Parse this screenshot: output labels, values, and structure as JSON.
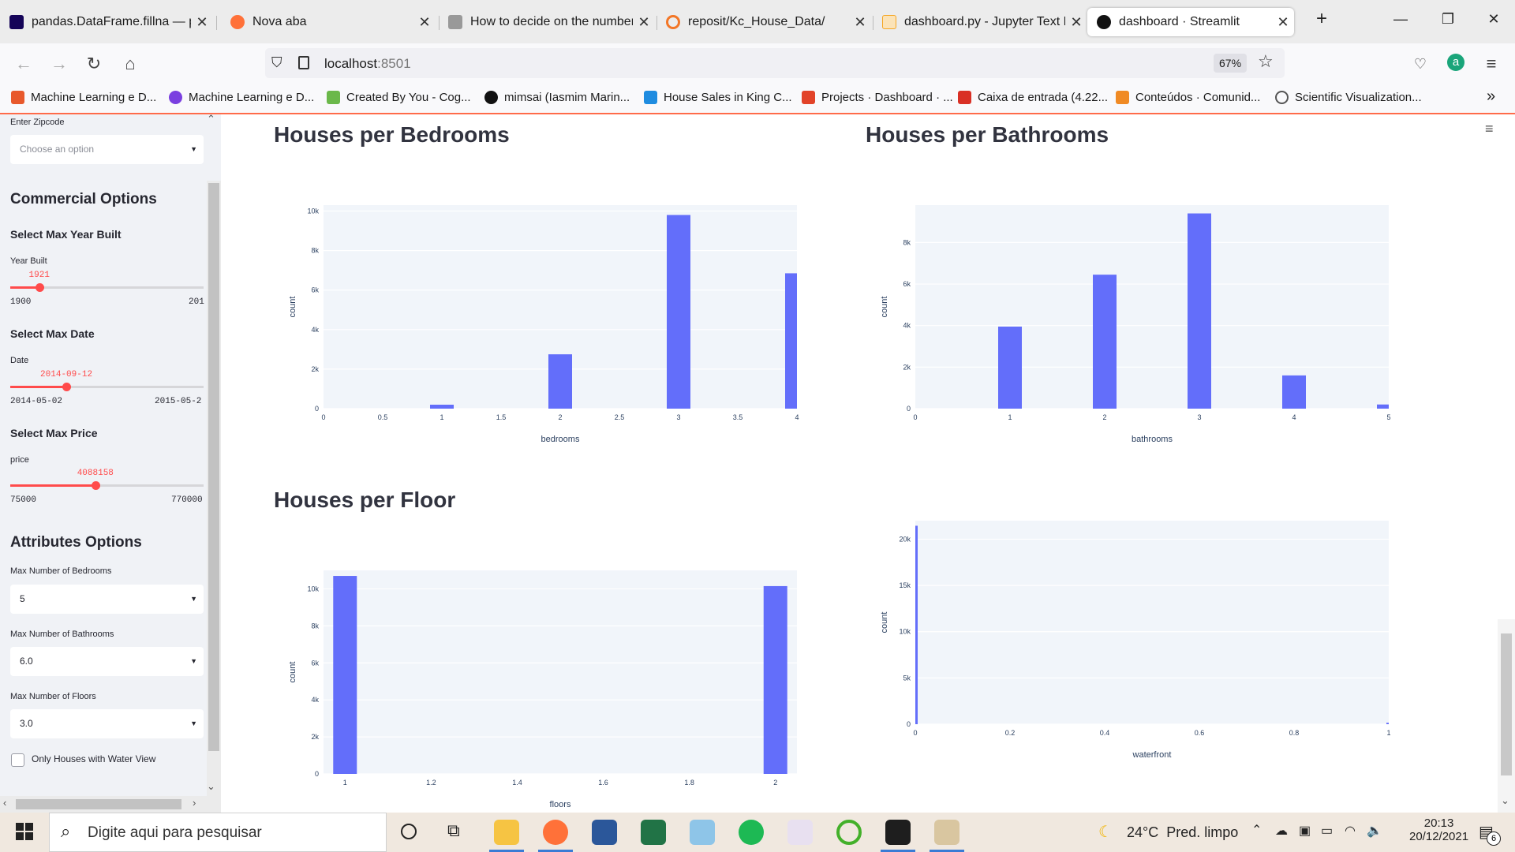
{
  "browser": {
    "tabs": [
      {
        "title": "pandas.DataFrame.fillna — par",
        "color": "#150458",
        "active": false
      },
      {
        "title": "Nova aba",
        "color": "#ff7139",
        "active": false
      },
      {
        "title": "How to decide on the number",
        "color": "#888888",
        "active": false
      },
      {
        "title": "reposit/Kc_House_Data/",
        "color": "#f37626",
        "active": false
      },
      {
        "title": "dashboard.py - Jupyter Text Ed",
        "color": "#f5a623",
        "active": false
      },
      {
        "title": "dashboard · Streamlit",
        "color": "#111111",
        "active": true
      }
    ],
    "new_tab": "+",
    "url_host": "localhost",
    "url_port": ":8501",
    "zoom": "67%",
    "bookmarks": [
      {
        "label": "Machine Learning e D...",
        "color": "#e8592c"
      },
      {
        "label": "Machine Learning e D...",
        "color": "#7a3fe0"
      },
      {
        "label": "Created By You - Cog...",
        "color": "#6bb84a"
      },
      {
        "label": "mimsai (Iasmim Marin...",
        "color": "#111111"
      },
      {
        "label": "House Sales in King C...",
        "color": "#1f8ce0"
      },
      {
        "label": "Projects · Dashboard · ...",
        "color": "#e24329"
      },
      {
        "label": "Caixa de entrada (4.22...",
        "color": "#d93025"
      },
      {
        "label": "Conteúdos · Comunid...",
        "color": "#f08a24"
      },
      {
        "label": "Scientific Visualization...",
        "color": "#555555"
      }
    ],
    "more": "»"
  },
  "sidebar": {
    "zipcode_label": "Enter Zipcode",
    "zipcode_placeholder": "Choose an option",
    "commercial_title": "Commercial Options",
    "year_title": "Select Max Year Built",
    "year_label": "Year Built",
    "year_value": "1921",
    "year_min": "1900",
    "year_max": "201",
    "year_fraction": 0.15,
    "date_title": "Select Max Date",
    "date_label": "Date",
    "date_value": "2014-09-12",
    "date_min": "2014-05-02",
    "date_max": "2015-05-2",
    "date_fraction": 0.29,
    "price_title": "Select Max Price",
    "price_label": "price",
    "price_value": "4088158",
    "price_min": "75000",
    "price_max": "770000",
    "price_fraction": 0.44,
    "attributes_title": "Attributes Options",
    "bedrooms_label": "Max Number of Bedrooms",
    "bedrooms_value": "5",
    "bathrooms_label": "Max Number of Bathrooms",
    "bathrooms_value": "6.0",
    "floors_label": "Max Number of Floors",
    "floors_value": "3.0",
    "waterview_label": "Only Houses with Water View"
  },
  "main": {
    "bedrooms_title": "Houses per Bedrooms",
    "bathrooms_title": "Houses per Bathrooms",
    "floors_title": "Houses per Floor"
  },
  "chart_data": [
    {
      "id": "bedrooms",
      "type": "bar",
      "xlabel": "bedrooms",
      "ylabel": "count",
      "xlim": [
        0,
        4
      ],
      "ylim": [
        0,
        10300
      ],
      "xticks": [
        "0",
        "0.5",
        "1",
        "1.5",
        "2",
        "2.5",
        "3",
        "3.5",
        "4"
      ],
      "yticks": [
        "0",
        "2k",
        "4k",
        "6k",
        "8k",
        "10k"
      ],
      "x": [
        1,
        2,
        3,
        4
      ],
      "values": [
        200,
        2750,
        9800,
        6850
      ],
      "bar_width": 0.05,
      "color": "#636efa"
    },
    {
      "id": "bathrooms",
      "type": "bar",
      "xlabel": "bathrooms",
      "ylabel": "count",
      "xlim": [
        0,
        5
      ],
      "ylim": [
        0,
        9800
      ],
      "xticks": [
        "0",
        "1",
        "2",
        "3",
        "4",
        "5"
      ],
      "yticks": [
        "0",
        "2k",
        "4k",
        "6k",
        "8k"
      ],
      "x": [
        1,
        2,
        3,
        4,
        5
      ],
      "values": [
        3950,
        6450,
        9400,
        1600,
        200
      ],
      "bar_width": 0.05,
      "color": "#636efa"
    },
    {
      "id": "floors",
      "type": "bar",
      "xlabel": "floors",
      "ylabel": "count",
      "xlim": [
        0.95,
        2.05
      ],
      "ylim": [
        0,
        11000
      ],
      "xticks": [
        "1",
        "1.2",
        "1.4",
        "1.6",
        "1.8",
        "2"
      ],
      "yticks": [
        "0",
        "2k",
        "4k",
        "6k",
        "8k",
        "10k"
      ],
      "x": [
        1,
        2
      ],
      "values": [
        10700,
        10150
      ],
      "bar_width": 0.05,
      "color": "#636efa"
    },
    {
      "id": "waterfront",
      "type": "bar",
      "xlabel": "waterfront",
      "ylabel": "count",
      "xlim": [
        0,
        1
      ],
      "ylim": [
        0,
        22000
      ],
      "xticks": [
        "0",
        "0.2",
        "0.4",
        "0.6",
        "0.8",
        "1"
      ],
      "yticks": [
        "0",
        "5k",
        "10k",
        "15k",
        "20k"
      ],
      "x": [
        0,
        1
      ],
      "values": [
        21450,
        160
      ],
      "bar_width": 0.01,
      "color": "#636efa"
    }
  ],
  "taskbar": {
    "search_placeholder": "Digite aqui para pesquisar",
    "weather": "24°C  Pred. limpo",
    "time": "20:13",
    "date": "20/12/2021",
    "notifications": "6"
  }
}
